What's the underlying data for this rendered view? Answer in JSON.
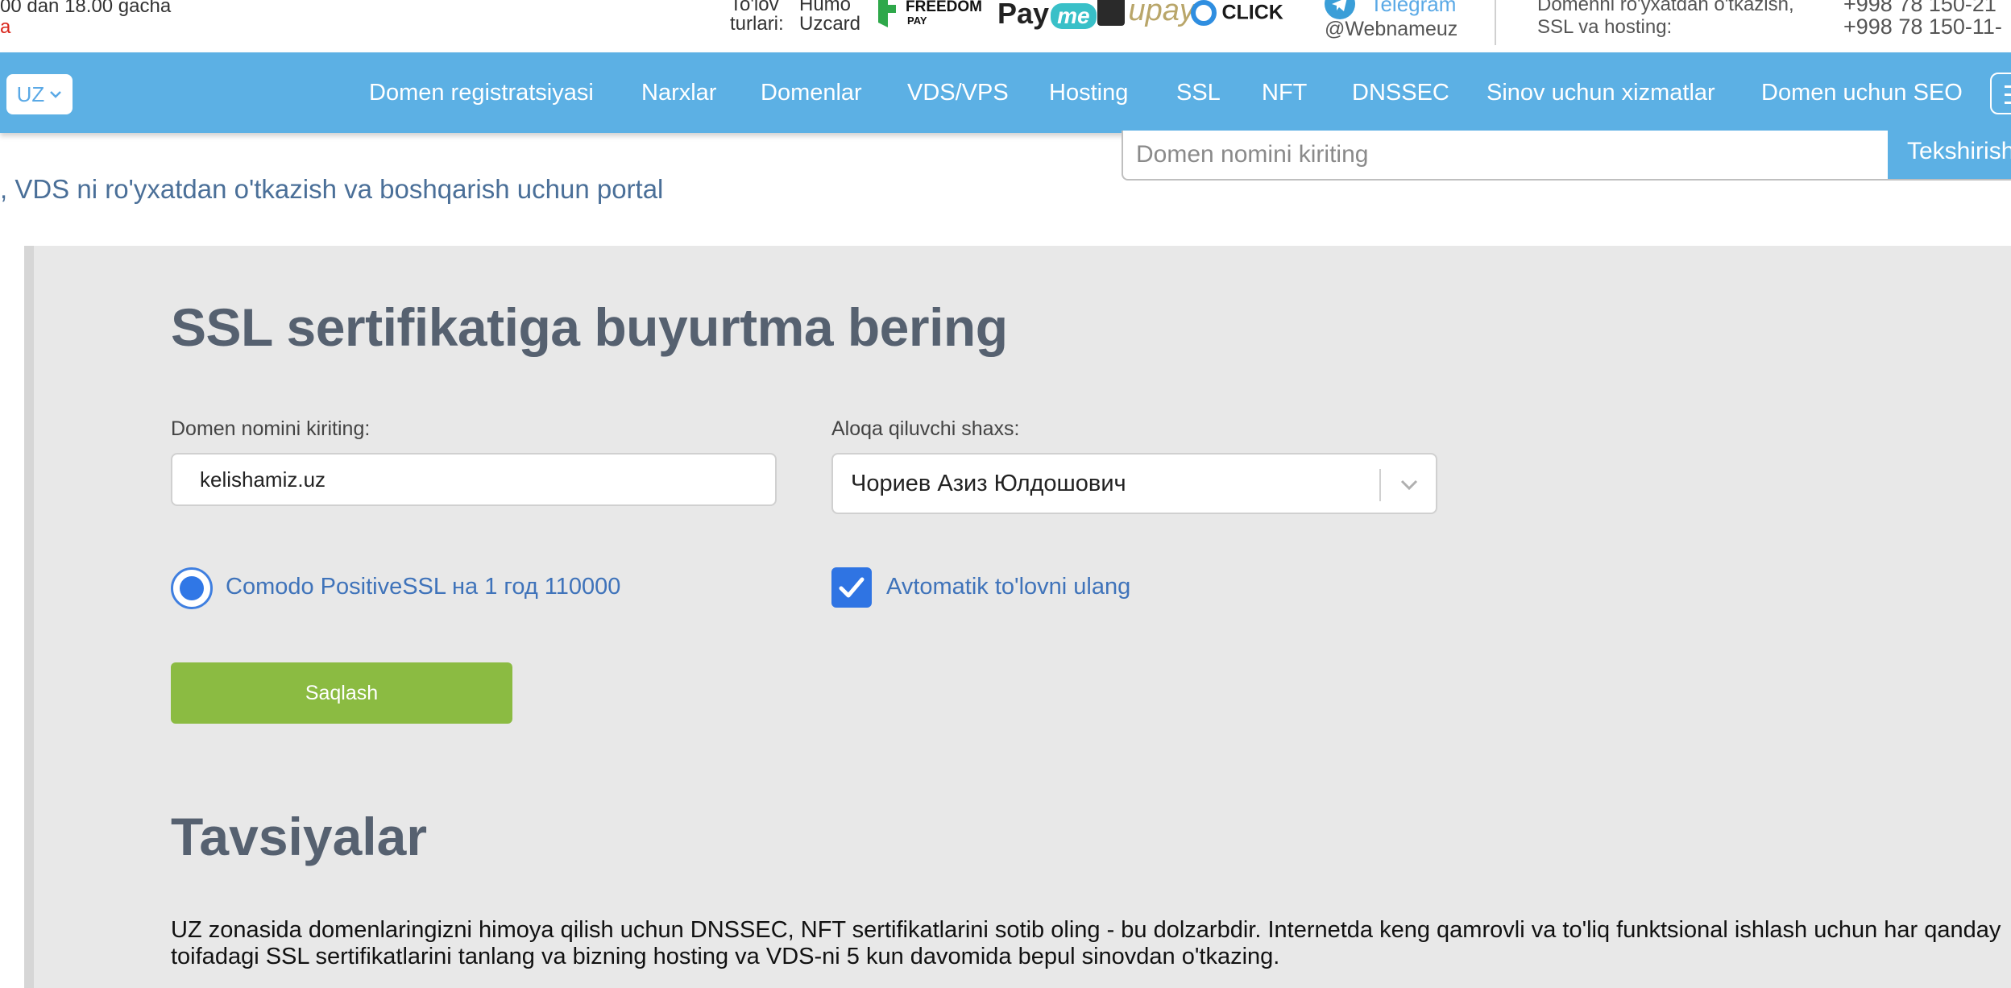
{
  "topbar": {
    "hours": "00 dan 18.00 gacha",
    "hours_second": "a",
    "payment_label_line1": "To'lov",
    "payment_label_line2": "turlari:",
    "humo": "Humo",
    "uzcard": "Uzcard",
    "freedom_line1": "FREEDOM",
    "freedom_line2": "PAY",
    "payme_pay": "Pay",
    "payme_me": "me",
    "upay": "upay",
    "click": "CLICK",
    "telegram": "Telegram",
    "telegram_handle": "@Webnameuz",
    "contact_line1": "Domenni ro'yxatdan o'tkazish,",
    "contact_line2": "SSL va hosting:",
    "phone1": "+998 78 150-21",
    "phone2": "+998 78 150-11-"
  },
  "nav": {
    "lang": "UZ",
    "items": [
      "Domen registratsiyasi",
      "Narxlar",
      "Domenlar",
      "VDS/VPS",
      "Hosting",
      "SSL",
      "NFT",
      "DNSSEC",
      "Sinov uchun xizmatlar",
      "Domen uchun SEO"
    ]
  },
  "search": {
    "placeholder": "Domen nomini kiriting",
    "button": "Tekshirish"
  },
  "tagline": ", VDS ni ro'yxatdan o'tkazish va boshqarish uchun portal",
  "form": {
    "title": "SSL sertifikatiga buyurtma bering",
    "domain_label": "Domen nomini kiriting:",
    "domain_value": "kelishamiz.uz",
    "contact_label": "Aloqa qiluvchi shaxs:",
    "contact_value": "Чориев Азиз Юлдошович",
    "ssl_option": "Comodo PositiveSSL на 1 год 110000",
    "autopay_label": "Avtomatik to'lovni ulang",
    "save_button": "Saqlash"
  },
  "recommendations": {
    "title": "Tavsiyalar",
    "line1": "UZ zonasida domenlaringizni himoya qilish uchun DNSSEC, NFT sertifikatlarini sotib oling - bu dolzarbdir. Internetda keng qamrovli va to'liq funktsional ishlash uchun har qanday",
    "line2": "toifadagi SSL sertifikatlarini tanlang va bizning hosting va VDS-ni 5 kun davomida bepul sinovdan o'tkazing."
  },
  "colors": {
    "nav_bg": "#5cb0e4",
    "save_green": "#8bbb42",
    "accent_blue": "#3077e6",
    "panel_bg": "#e8e8e8"
  },
  "icons": [
    "chevron-down-icon",
    "telegram-icon",
    "menu-icon",
    "check-icon",
    "radio-icon"
  ]
}
